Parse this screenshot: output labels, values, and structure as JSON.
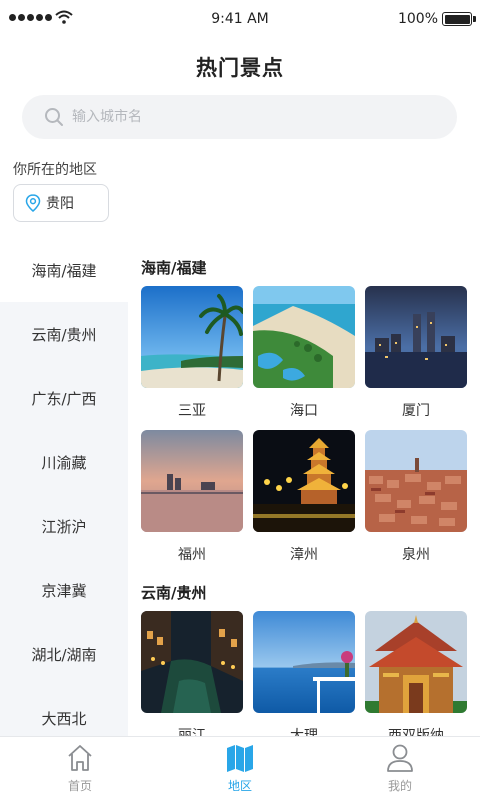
{
  "status_bar": {
    "time": "9:41 AM",
    "battery": "100%"
  },
  "header": {
    "title": "热门景点"
  },
  "search": {
    "placeholder": "输入城市名"
  },
  "location": {
    "label": "你所在的地区",
    "city": "贵阳"
  },
  "sidebar": {
    "items": [
      {
        "label": "海南/福建",
        "active": true
      },
      {
        "label": "云南/贵州",
        "active": false
      },
      {
        "label": "广东/广西",
        "active": false
      },
      {
        "label": "川渝藏",
        "active": false
      },
      {
        "label": "江浙沪",
        "active": false
      },
      {
        "label": "京津冀",
        "active": false
      },
      {
        "label": "湖北/湖南",
        "active": false
      },
      {
        "label": "大西北",
        "active": false
      }
    ]
  },
  "sections": [
    {
      "title": "海南/福建",
      "spots": [
        "三亚",
        "海口",
        "厦门",
        "福州",
        "漳州",
        "泉州"
      ]
    },
    {
      "title": "云南/贵州",
      "spots": [
        "丽江",
        "大理",
        "西双版纳"
      ]
    }
  ],
  "tabbar": {
    "items": [
      {
        "label": "首页",
        "icon": "home-icon",
        "active": false
      },
      {
        "label": "地区",
        "icon": "map-icon",
        "active": true
      },
      {
        "label": "我的",
        "icon": "user-icon",
        "active": false
      }
    ]
  },
  "colors": {
    "accent": "#29a6e8",
    "sidebar_bg": "#f4f6f9",
    "search_bg": "#f2f3f5"
  }
}
